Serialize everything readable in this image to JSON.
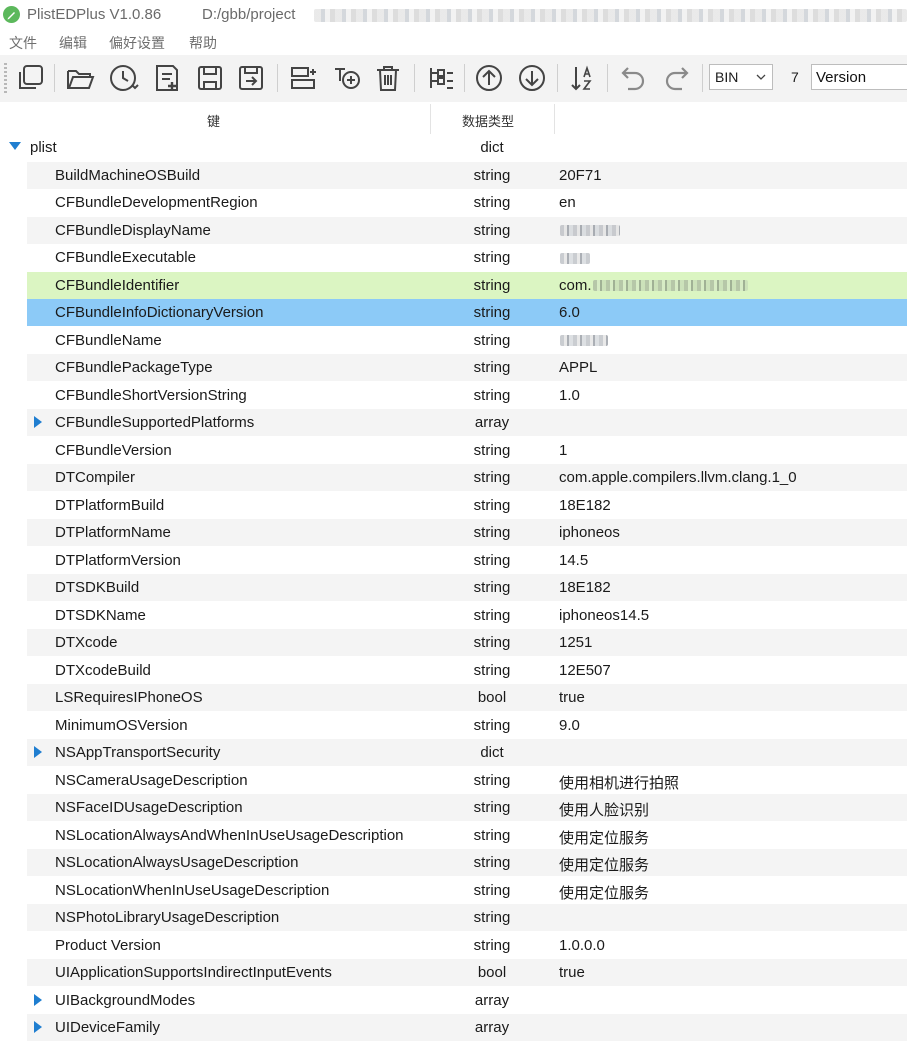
{
  "window": {
    "app_title": "PlistEDPlus  V1.0.86",
    "path": "D:/gbb/project"
  },
  "menu": [
    "文件",
    "编辑",
    "偏好设置",
    "帮助"
  ],
  "toolbar": {
    "icons": [
      "copy-icon",
      "open-folder-icon",
      "recent-files-icon",
      "new-file-icon",
      "save-icon",
      "save-as-icon",
      "add-child-icon",
      "add-item-icon",
      "delete-icon",
      "tree-expand-icon",
      "move-up-icon",
      "move-down-icon",
      "sort-icon",
      "undo-icon",
      "redo-icon"
    ],
    "format_value": "BIN",
    "match_count": "7",
    "search_value": "Version"
  },
  "columns": {
    "key": "键",
    "type": "数据类型"
  },
  "accent": "#1f7ed0",
  "highlight_colors": {
    "green": "#dbf5c2",
    "selected": "#8ccaf7"
  },
  "rows": [
    {
      "key": "plist",
      "type": "dict",
      "value": "",
      "level": 0,
      "toggle": "down",
      "style": ""
    },
    {
      "key": "BuildMachineOSBuild",
      "type": "string",
      "value": "20F71",
      "level": 1,
      "toggle": "",
      "style": "alt"
    },
    {
      "key": "CFBundleDevelopmentRegion",
      "type": "string",
      "value": "en",
      "level": 1,
      "toggle": "",
      "style": ""
    },
    {
      "key": "CFBundleDisplayName",
      "type": "string",
      "value": "",
      "level": 1,
      "toggle": "",
      "style": "alt"
    },
    {
      "key": "CFBundleExecutable",
      "type": "string",
      "value": "",
      "level": 1,
      "toggle": "",
      "style": ""
    },
    {
      "key": "CFBundleIdentifier",
      "type": "string",
      "value": "com.",
      "level": 1,
      "toggle": "",
      "style": "green"
    },
    {
      "key": "CFBundleInfoDictionaryVersion",
      "type": "string",
      "value": "6.0",
      "level": 1,
      "toggle": "",
      "style": "selected"
    },
    {
      "key": "CFBundleName",
      "type": "string",
      "value": "",
      "level": 1,
      "toggle": "",
      "style": ""
    },
    {
      "key": "CFBundlePackageType",
      "type": "string",
      "value": "APPL",
      "level": 1,
      "toggle": "",
      "style": "alt"
    },
    {
      "key": "CFBundleShortVersionString",
      "type": "string",
      "value": "1.0",
      "level": 1,
      "toggle": "",
      "style": ""
    },
    {
      "key": "CFBundleSupportedPlatforms",
      "type": "array",
      "value": "",
      "level": 1,
      "toggle": "right",
      "style": "alt"
    },
    {
      "key": "CFBundleVersion",
      "type": "string",
      "value": "1",
      "level": 1,
      "toggle": "",
      "style": ""
    },
    {
      "key": "DTCompiler",
      "type": "string",
      "value": "com.apple.compilers.llvm.clang.1_0",
      "level": 1,
      "toggle": "",
      "style": "alt"
    },
    {
      "key": "DTPlatformBuild",
      "type": "string",
      "value": "18E182",
      "level": 1,
      "toggle": "",
      "style": ""
    },
    {
      "key": "DTPlatformName",
      "type": "string",
      "value": "iphoneos",
      "level": 1,
      "toggle": "",
      "style": "alt"
    },
    {
      "key": "DTPlatformVersion",
      "type": "string",
      "value": "14.5",
      "level": 1,
      "toggle": "",
      "style": ""
    },
    {
      "key": "DTSDKBuild",
      "type": "string",
      "value": "18E182",
      "level": 1,
      "toggle": "",
      "style": "alt"
    },
    {
      "key": "DTSDKName",
      "type": "string",
      "value": "iphoneos14.5",
      "level": 1,
      "toggle": "",
      "style": ""
    },
    {
      "key": "DTXcode",
      "type": "string",
      "value": "1251",
      "level": 1,
      "toggle": "",
      "style": "alt"
    },
    {
      "key": "DTXcodeBuild",
      "type": "string",
      "value": "12E507",
      "level": 1,
      "toggle": "",
      "style": ""
    },
    {
      "key": "LSRequiresIPhoneOS",
      "type": "bool",
      "value": "true",
      "level": 1,
      "toggle": "",
      "style": "alt"
    },
    {
      "key": "MinimumOSVersion",
      "type": "string",
      "value": "9.0",
      "level": 1,
      "toggle": "",
      "style": ""
    },
    {
      "key": "NSAppTransportSecurity",
      "type": "dict",
      "value": "",
      "level": 1,
      "toggle": "right",
      "style": "alt"
    },
    {
      "key": "NSCameraUsageDescription",
      "type": "string",
      "value": "使用相机进行拍照",
      "level": 1,
      "toggle": "",
      "style": ""
    },
    {
      "key": "NSFaceIDUsageDescription",
      "type": "string",
      "value": "使用人脸识别",
      "level": 1,
      "toggle": "",
      "style": "alt"
    },
    {
      "key": "NSLocationAlwaysAndWhenInUseUsageDescription",
      "type": "string",
      "value": "使用定位服务",
      "level": 1,
      "toggle": "",
      "style": ""
    },
    {
      "key": "NSLocationAlwaysUsageDescription",
      "type": "string",
      "value": "使用定位服务",
      "level": 1,
      "toggle": "",
      "style": "alt"
    },
    {
      "key": "NSLocationWhenInUseUsageDescription",
      "type": "string",
      "value": "使用定位服务",
      "level": 1,
      "toggle": "",
      "style": ""
    },
    {
      "key": "NSPhotoLibraryUsageDescription",
      "type": "string",
      "value": "",
      "level": 1,
      "toggle": "",
      "style": "alt"
    },
    {
      "key": "Product Version",
      "type": "string",
      "value": "1.0.0.0",
      "level": 1,
      "toggle": "",
      "style": ""
    },
    {
      "key": "UIApplicationSupportsIndirectInputEvents",
      "type": "bool",
      "value": "true",
      "level": 1,
      "toggle": "",
      "style": "alt"
    },
    {
      "key": "UIBackgroundModes",
      "type": "array",
      "value": "",
      "level": 1,
      "toggle": "right",
      "style": ""
    },
    {
      "key": "UIDeviceFamily",
      "type": "array",
      "value": "",
      "level": 1,
      "toggle": "right",
      "style": "alt"
    }
  ]
}
